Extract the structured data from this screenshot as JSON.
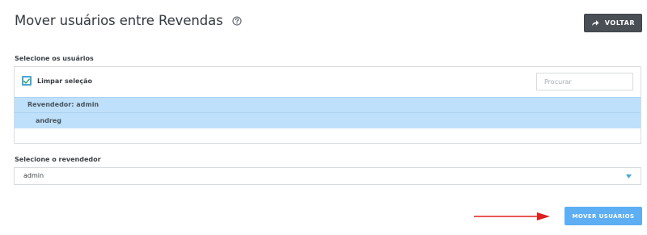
{
  "header": {
    "title": "Mover usuários entre Revendas",
    "help_icon": "help-circle-icon",
    "back_button_label": "VOLTAR",
    "back_icon": "arrow-share-icon"
  },
  "users_section": {
    "label": "Selecione os usuários",
    "clear_selection_label": "Limpar seleção",
    "clear_selection_checked": true,
    "search_placeholder": "Procurar",
    "group_label": "Revendedor: admin",
    "users": [
      {
        "name": "andreg",
        "selected": true
      }
    ]
  },
  "reseller_section": {
    "label": "Selecione o revendedor",
    "selected_value": "admin",
    "caret_icon": "triangle-down-icon"
  },
  "actions": {
    "move_button_label": "MOVER USUÁRIOS"
  },
  "colors": {
    "primary": "#5daef2",
    "selection_bg": "#bfe0fa",
    "dark_button": "#4a4f55",
    "annotation_arrow": "#e0201b"
  }
}
